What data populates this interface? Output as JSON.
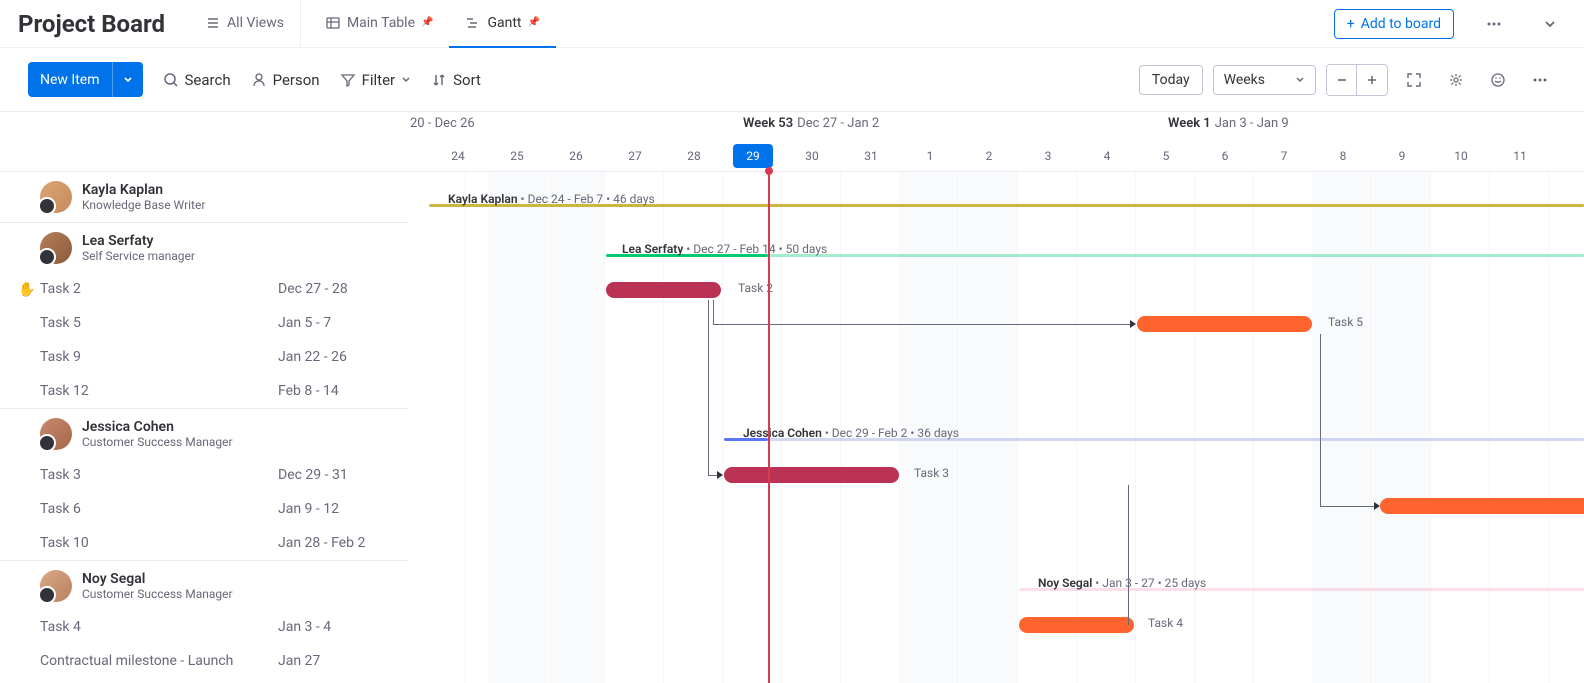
{
  "header": {
    "title": "Project Board",
    "views": {
      "all": "All Views",
      "main_table": "Main Table",
      "gantt": "Gantt"
    },
    "add_to_board": "Add to board"
  },
  "toolbar": {
    "new_item": "New Item",
    "search": "Search",
    "person": "Person",
    "filter": "Filter",
    "sort": "Sort",
    "today": "Today",
    "scale": "Weeks"
  },
  "timeline": {
    "left_partial": "20 - Dec 26",
    "week53_label": "Week 53",
    "week53_range": "Dec 27 - Jan 2",
    "week1_label": "Week 1",
    "week1_range": "Jan 3 - Jan 9",
    "days": [
      "24",
      "25",
      "26",
      "27",
      "28",
      "29",
      "30",
      "31",
      "1",
      "2",
      "3",
      "4",
      "5",
      "6",
      "7",
      "8",
      "9",
      "10",
      "11"
    ],
    "today_day": "29"
  },
  "people": [
    {
      "name": "Kayla Kaplan",
      "role": "Knowledge Base Writer"
    },
    {
      "name": "Lea Serfaty",
      "role": "Self Service manager"
    },
    {
      "name": "Jessica Cohen",
      "role": "Customer Success Manager"
    },
    {
      "name": "Noy Segal",
      "role": "Customer Success Manager"
    }
  ],
  "tasks": {
    "lea": [
      {
        "name": "Task 2",
        "dates": "Dec 27 - 28"
      },
      {
        "name": "Task 5",
        "dates": "Jan 5 - 7"
      },
      {
        "name": "Task 9",
        "dates": "Jan 22 - 26"
      },
      {
        "name": "Task 12",
        "dates": "Feb 8 - 14"
      }
    ],
    "jessica": [
      {
        "name": "Task 3",
        "dates": "Dec 29 - 31"
      },
      {
        "name": "Task 6",
        "dates": "Jan 9 - 12"
      },
      {
        "name": "Task 10",
        "dates": "Jan 28 - Feb 2"
      }
    ],
    "noy": [
      {
        "name": "Task 4",
        "dates": "Jan 3 - 4"
      },
      {
        "name": "Contractual milestone - Launch",
        "dates": "Jan 27"
      }
    ]
  },
  "bars": {
    "kayla_summary": {
      "name": "Kayla Kaplan",
      "range": "Dec 24 - Feb 7",
      "days": "46 days"
    },
    "lea_summary": {
      "name": "Lea Serfaty",
      "range": "Dec 27 - Feb 14",
      "days": "50 days"
    },
    "jessica_summary": {
      "name": "Jessica Cohen",
      "range": "Dec 29 - Feb 2",
      "days": "36 days"
    },
    "noy_summary": {
      "name": "Noy Segal",
      "range": "Jan 3 - 27",
      "days": "25 days"
    },
    "task2": "Task 2",
    "task5": "Task 5",
    "task3": "Task 3",
    "task4": "Task 4"
  },
  "chart_data": {
    "type": "gantt",
    "today": "2020-12-29",
    "time_scale": "Weeks",
    "visible_range": [
      "2020-12-24",
      "2021-01-11"
    ],
    "groups": [
      {
        "person": "Kayla Kaplan",
        "role": "Knowledge Base Writer",
        "summary": {
          "start": "2020-12-24",
          "end": "2021-02-07",
          "duration_days": 46,
          "color": "#CAB641"
        },
        "tasks": []
      },
      {
        "person": "Lea Serfaty",
        "role": "Self Service manager",
        "summary": {
          "start": "2020-12-27",
          "end": "2021-02-14",
          "duration_days": 50,
          "color": "#00C875"
        },
        "tasks": [
          {
            "name": "Task 2",
            "start": "2020-12-27",
            "end": "2020-12-28",
            "color": "#BB3354"
          },
          {
            "name": "Task 5",
            "start": "2021-01-05",
            "end": "2021-01-07",
            "color": "#FF642E",
            "depends_on": "Task 2"
          },
          {
            "name": "Task 9",
            "start": "2021-01-22",
            "end": "2021-01-26"
          },
          {
            "name": "Task 12",
            "start": "2021-02-08",
            "end": "2021-02-14"
          }
        ]
      },
      {
        "person": "Jessica Cohen",
        "role": "Customer Success Manager",
        "summary": {
          "start": "2020-12-29",
          "end": "2021-02-02",
          "duration_days": 36,
          "color": "#7E8CE0"
        },
        "tasks": [
          {
            "name": "Task 3",
            "start": "2020-12-29",
            "end": "2020-12-31",
            "color": "#BB3354",
            "depends_on": "Task 2"
          },
          {
            "name": "Task 6",
            "start": "2021-01-09",
            "end": "2021-01-12",
            "color": "#FF642E",
            "depends_on": "Task 5"
          },
          {
            "name": "Task 10",
            "start": "2021-01-28",
            "end": "2021-02-02"
          }
        ]
      },
      {
        "person": "Noy Segal",
        "role": "Customer Success Manager",
        "summary": {
          "start": "2021-01-03",
          "end": "2021-01-27",
          "duration_days": 25,
          "color": "#FAA1C7"
        },
        "tasks": [
          {
            "name": "Task 4",
            "start": "2021-01-03",
            "end": "2021-01-04",
            "color": "#FF642E",
            "depends_on": "Task 3"
          },
          {
            "name": "Contractual milestone - Launch",
            "start": "2021-01-27",
            "end": "2021-01-27"
          }
        ]
      }
    ]
  }
}
